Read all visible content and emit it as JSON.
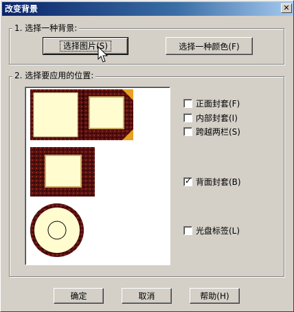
{
  "window": {
    "title": "改变背景",
    "close_glyph": "✕"
  },
  "section1": {
    "legend": "1.  选择一种背景:",
    "choose_picture_label": "选择图片(S)",
    "choose_color_label": "选择一种颜色(F)"
  },
  "section2": {
    "legend": "2.  选择要应用的位置:",
    "options": [
      {
        "label": "正面封套(F)",
        "checked": false
      },
      {
        "label": "内部封套(I)",
        "checked": false
      },
      {
        "label": "跨越两栏(S)",
        "checked": false
      },
      {
        "label": "背面封套(B)",
        "checked": true
      },
      {
        "label": "光盘标签(L)",
        "checked": false
      }
    ],
    "check_mark": "✓"
  },
  "footer": {
    "ok_label": "确定",
    "cancel_label": "取消",
    "help_label": "帮助(H)"
  },
  "colors": {
    "cover_dark": "#3a0a0a",
    "cover_red": "#7a1a1a",
    "paper": "#fffdd0",
    "corner_gold": "#e8a020"
  },
  "icons": [
    "close-icon",
    "check-icon",
    "mouse-pointer-icon"
  ]
}
